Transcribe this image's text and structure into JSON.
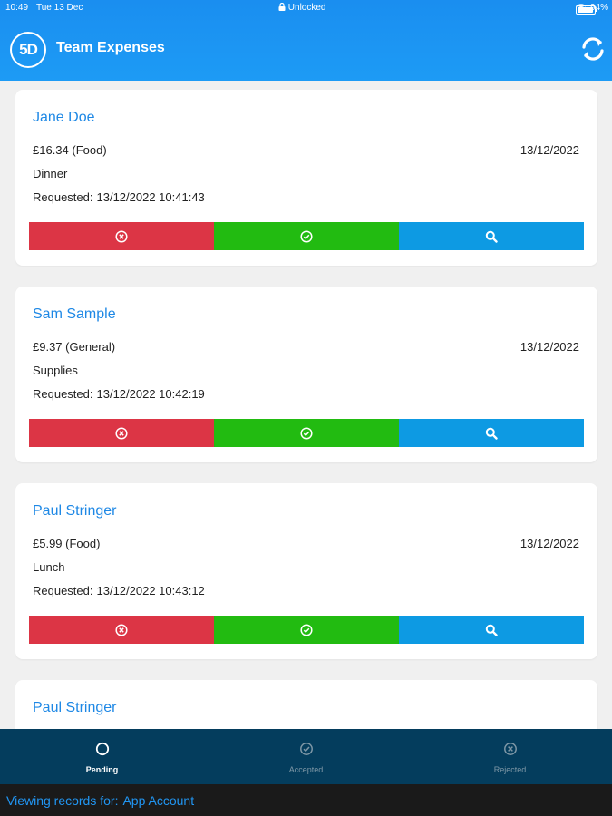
{
  "status_bar": {
    "time": "10:49",
    "date": "Tue 13 Dec",
    "lock_status": "Unlocked",
    "battery": "94%"
  },
  "header": {
    "logo_text": "5D",
    "title": "Team Expenses",
    "refresh_icon": "refresh-icon"
  },
  "expenses": [
    {
      "name": "Jane Doe",
      "amount": "£16.34 (Food)",
      "date": "13/12/2022",
      "description": "Dinner",
      "requested_label": "Requested:",
      "requested": "13/12/2022 10:41:43"
    },
    {
      "name": "Sam Sample",
      "amount": "£9.37 (General)",
      "date": "13/12/2022",
      "description": "Supplies",
      "requested_label": "Requested:",
      "requested": "13/12/2022 10:42:19"
    },
    {
      "name": "Paul Stringer",
      "amount": "£5.99 (Food)",
      "date": "13/12/2022",
      "description": "Lunch",
      "requested_label": "Requested:",
      "requested": "13/12/2022 10:43:12"
    },
    {
      "name": "Paul Stringer"
    }
  ],
  "actions": {
    "reject_icon": "reject-circle-icon",
    "accept_icon": "check-circle-icon",
    "view_icon": "search-icon"
  },
  "tabs": [
    {
      "label": "Pending",
      "icon": "circle-icon",
      "active": true
    },
    {
      "label": "Accepted",
      "icon": "check-circle-icon",
      "active": false
    },
    {
      "label": "Rejected",
      "icon": "x-circle-icon",
      "active": false
    }
  ],
  "footer": {
    "prefix": "Viewing records for:",
    "account": "App Account"
  },
  "colors": {
    "header": "#1d9bf5",
    "reject": "#dc3545",
    "accept": "#22bb11",
    "view": "#0d9ae3",
    "tabbar": "#043d5d",
    "footer": "#1a1a1a",
    "name": "#1e88e5"
  }
}
